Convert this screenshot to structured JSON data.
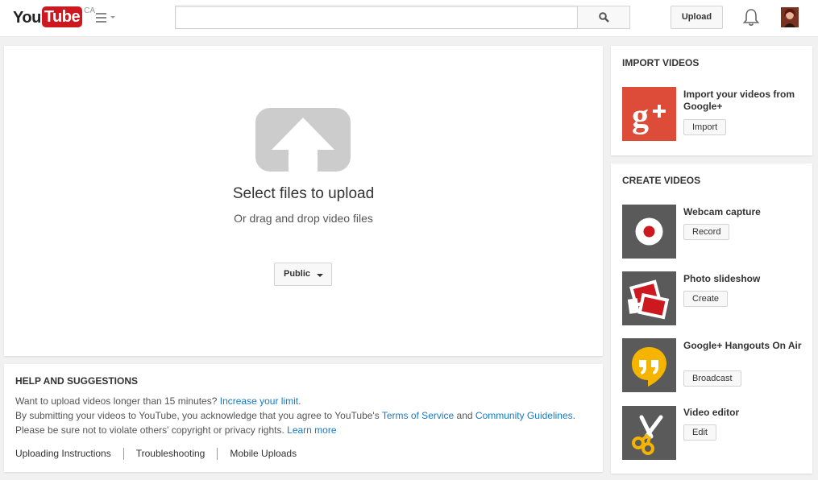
{
  "masthead": {
    "logo_you": "You",
    "logo_tube": "Tube",
    "country": "CA",
    "search_placeholder": "",
    "upload_label": "Upload"
  },
  "upload": {
    "title": "Select files to upload",
    "subtitle": "Or drag and drop video files",
    "privacy_value": "Public"
  },
  "help": {
    "title": "HELP AND SUGGESTIONS",
    "line1_text": "Want to upload videos longer than 15 minutes?",
    "line1_link": "Increase your limit",
    "line1_end": ".",
    "line2_text": "By submitting your videos to YouTube, you acknowledge that you agree to YouTube's",
    "line2_link1": "Terms of Service",
    "line2_and": "and",
    "line2_link2": "Community Guidelines",
    "line2_end": ".",
    "line3_text": "Please be sure not to violate others' copyright or privacy rights.",
    "line3_link": "Learn more",
    "links": [
      "Uploading Instructions",
      "Troubleshooting",
      "Mobile Uploads"
    ]
  },
  "import": {
    "title": "IMPORT VIDEOS",
    "item_title": "Import your videos from Google+",
    "item_button": "Import",
    "item_icon": "google-plus-icon"
  },
  "create": {
    "title": "CREATE VIDEOS",
    "items": [
      {
        "title": "Webcam capture",
        "button": "Record",
        "icon": "webcam-record-icon"
      },
      {
        "title": "Photo slideshow",
        "button": "Create",
        "icon": "photo-slideshow-icon"
      },
      {
        "title": "Google+ Hangouts On Air",
        "button": "Broadcast",
        "icon": "hangouts-icon"
      },
      {
        "title": "Video editor",
        "button": "Edit",
        "icon": "scissors-icon"
      }
    ]
  },
  "colors": {
    "brand_red": "#cc181e",
    "link_blue": "#167ac6",
    "google_plus_red": "#dd4b39",
    "hangouts_yellow": "#f4b400",
    "tile_gray": "#5a5a5a"
  }
}
